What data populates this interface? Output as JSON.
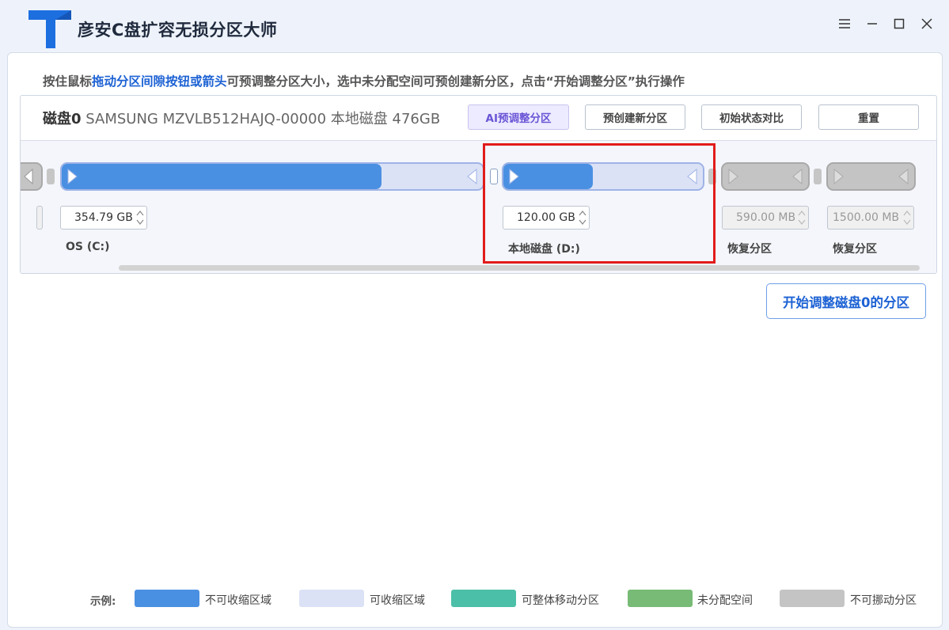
{
  "app": {
    "title": "彦安C盘扩容无损分区大师"
  },
  "hint": {
    "part1": "按住鼠标",
    "part2": "拖动分区间隙按钮或箭头",
    "part3": "可预调整分区大小，选中未分配空间可预创建新分区，点击“开始调整分区”执行操作"
  },
  "disk": {
    "name": "磁盘0",
    "info": " SAMSUNG MZVLB512HAJQ-00000 本地磁盘 476GB",
    "buttons": {
      "ai": "AI预调整分区",
      "create": "预创建新分区",
      "compare": "初始状态对比",
      "reset": "重置"
    }
  },
  "partitions": [
    {
      "size": "354.79 GB",
      "label": "OS (C:)",
      "fill_fraction": 0.76
    },
    {
      "size": "120.00 GB",
      "label": "本地磁盘 (D:)",
      "fill_fraction": 0.45
    },
    {
      "size": "590.00 MB",
      "label": "恢复分区"
    },
    {
      "size": "1500.00 MB",
      "label": "恢复分区"
    }
  ],
  "start_button": "开始调整磁盘0的分区",
  "legend": {
    "title": "示例:",
    "items": [
      {
        "label": "不可收缩区域",
        "color": "#4a90e2"
      },
      {
        "label": "可收缩区域",
        "color": "#dbe2f6"
      },
      {
        "label": "可整体移动分区",
        "color": "#4cbfa8"
      },
      {
        "label": "未分配空间",
        "color": "#78bb76"
      },
      {
        "label": "不可挪动分区",
        "color": "#c4c4c4"
      }
    ]
  },
  "colors": {
    "accent": "#1d62d4",
    "highlight": "#e21b1b"
  }
}
